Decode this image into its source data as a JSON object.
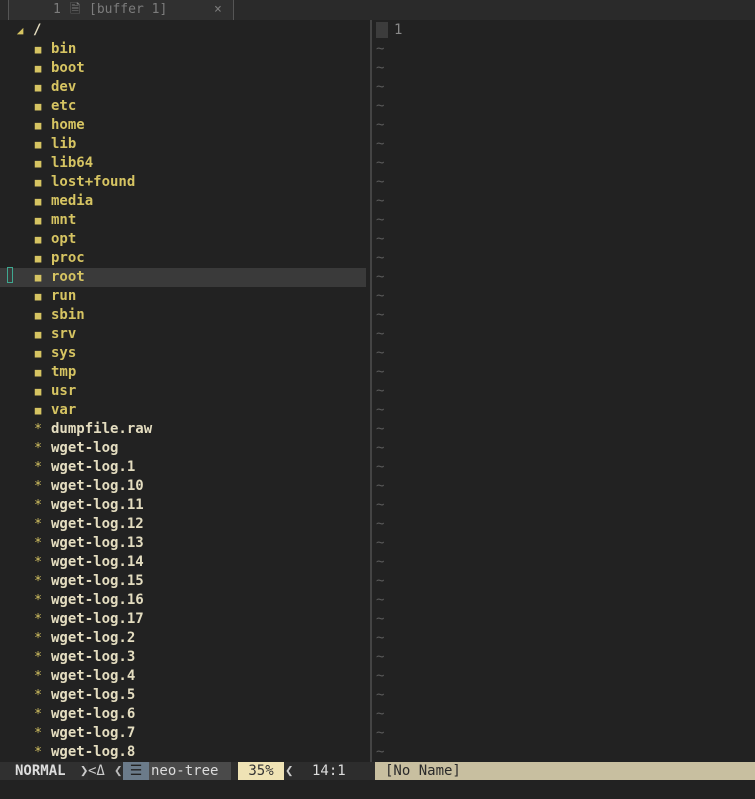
{
  "tabline": {
    "tab_number": "1",
    "tab_name": "[buffer 1]",
    "close_glyph": "×",
    "doc_icon": "document-icon"
  },
  "tree": {
    "root_label": "/",
    "directories": [
      "bin",
      "boot",
      "dev",
      "etc",
      "home",
      "lib",
      "lib64",
      "lost+found",
      "media",
      "mnt",
      "opt",
      "proc",
      "root",
      "run",
      "sbin",
      "srv",
      "sys",
      "tmp",
      "usr",
      "var"
    ],
    "files": [
      "dumpfile.raw",
      "wget-log",
      "wget-log.1",
      "wget-log.10",
      "wget-log.11",
      "wget-log.12",
      "wget-log.13",
      "wget-log.14",
      "wget-log.15",
      "wget-log.16",
      "wget-log.17",
      "wget-log.2",
      "wget-log.3",
      "wget-log.4",
      "wget-log.5",
      "wget-log.6",
      "wget-log.7",
      "wget-log.8"
    ],
    "selected": "root"
  },
  "editor": {
    "line_number": "1",
    "tilde": "~"
  },
  "statusline": {
    "mode": "NORMAL",
    "git_symbol": "<Δ",
    "filetype": "neo-tree",
    "percent": "35%",
    "position": "14:1",
    "buffer_name": "[No Name]"
  },
  "colors": {
    "directory": "#d6c462",
    "file": "#e4ddc0",
    "background": "#222222",
    "cursorline": "#3a3a3a"
  }
}
